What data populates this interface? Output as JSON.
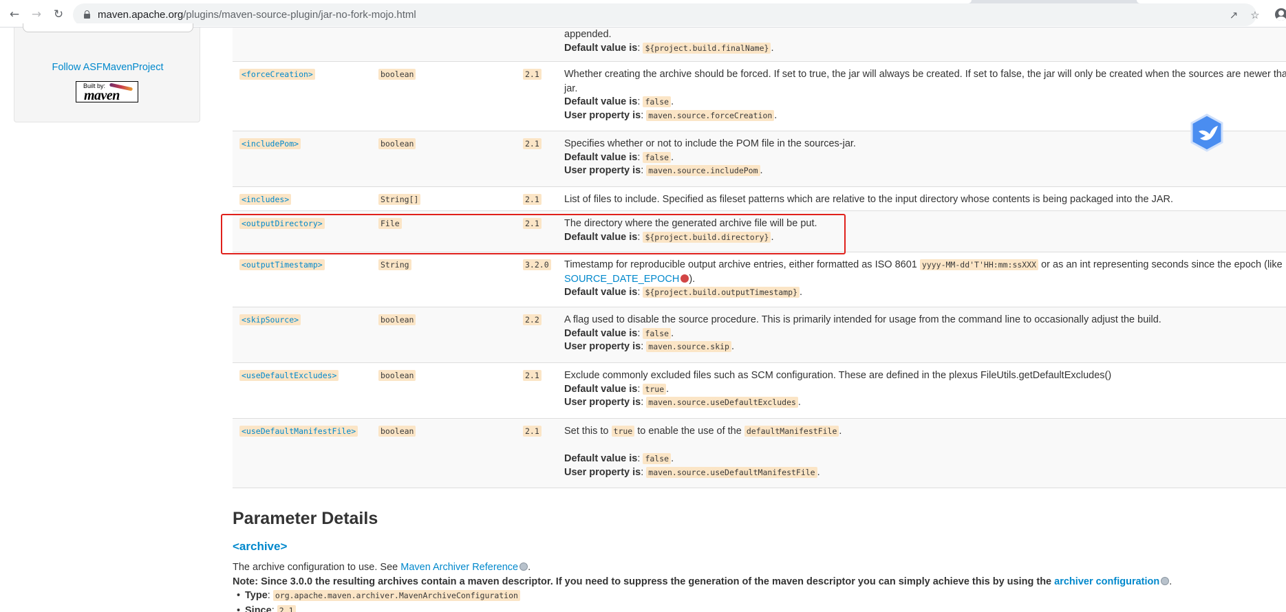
{
  "browser": {
    "url_domain": "maven.apache.org",
    "url_path": "/plugins/maven-source-plugin/jar-no-fork-mojo.html"
  },
  "sidebar": {
    "follow_link": "Follow ASFMavenProject",
    "built_by_small": "Built by:",
    "built_by_big": "maven"
  },
  "params": [
    {
      "name": "",
      "type": "",
      "since": "",
      "lines": [
        {
          "kind": "text",
          "text": "appended."
        },
        {
          "kind": "default",
          "label": "Default value is",
          "value": "${project.build.finalName}"
        }
      ]
    },
    {
      "name": "<forceCreation>",
      "type": "boolean",
      "since": "2.1",
      "lines": [
        {
          "kind": "text",
          "text": "Whether creating the archive should be forced. If set to true, the jar will always be created. If set to false, the jar will only be created when the sources are newer than the"
        },
        {
          "kind": "text",
          "text": "jar."
        },
        {
          "kind": "default",
          "label": "Default value is",
          "value": "false"
        },
        {
          "kind": "default",
          "label": "User property is",
          "value": "maven.source.forceCreation"
        }
      ]
    },
    {
      "name": "<includePom>",
      "type": "boolean",
      "since": "2.1",
      "lines": [
        {
          "kind": "text",
          "text": "Specifies whether or not to include the POM file in the sources-jar."
        },
        {
          "kind": "default",
          "label": "Default value is",
          "value": "false"
        },
        {
          "kind": "default",
          "label": "User property is",
          "value": "maven.source.includePom"
        }
      ]
    },
    {
      "name": "<includes>",
      "type": "String[]",
      "since": "2.1",
      "lines": [
        {
          "kind": "text",
          "text": "List of files to include. Specified as fileset patterns which are relative to the input directory whose contents is being packaged into the JAR."
        }
      ]
    },
    {
      "name": "<outputDirectory>",
      "type": "File",
      "since": "2.1",
      "lines": [
        {
          "kind": "text",
          "text": "The directory where the generated archive file will be put."
        },
        {
          "kind": "default",
          "label": "Default value is",
          "value": "${project.build.directory}"
        }
      ]
    },
    {
      "name": "<outputTimestamp>",
      "type": "String",
      "since": "3.2.0",
      "lines": [
        {
          "kind": "timestamp",
          "pre": "Timestamp for reproducible output archive entries, either formatted as ISO 8601 ",
          "code": "yyyy-MM-dd'T'HH:mm:ssXXX",
          "post": " or as an int representing seconds since the epoch (like"
        },
        {
          "kind": "linkline",
          "link": "SOURCE_DATE_EPOCH",
          "post": ")."
        },
        {
          "kind": "default",
          "label": "Default value is",
          "value": "${project.build.outputTimestamp}"
        }
      ]
    },
    {
      "name": "<skipSource>",
      "type": "boolean",
      "since": "2.2",
      "lines": [
        {
          "kind": "text",
          "text": "A flag used to disable the source procedure. This is primarily intended for usage from the command line to occasionally adjust the build."
        },
        {
          "kind": "default",
          "label": "Default value is",
          "value": "false"
        },
        {
          "kind": "default",
          "label": "User property is",
          "value": "maven.source.skip"
        }
      ]
    },
    {
      "name": "<useDefaultExcludes>",
      "type": "boolean",
      "since": "2.1",
      "lines": [
        {
          "kind": "text",
          "text": "Exclude commonly excluded files such as SCM configuration. These are defined in the plexus FileUtils.getDefaultExcludes()"
        },
        {
          "kind": "default",
          "label": "Default value is",
          "value": "true"
        },
        {
          "kind": "default",
          "label": "User property is",
          "value": "maven.source.useDefaultExcludes"
        }
      ]
    },
    {
      "name": "<useDefaultManifestFile>",
      "type": "boolean",
      "since": "2.1",
      "lines": [
        {
          "kind": "manifest",
          "pre": "Set this to ",
          "code1": "true",
          "mid": " to enable the use of the ",
          "code2": "defaultManifestFile",
          "post": "."
        },
        {
          "kind": "blank"
        },
        {
          "kind": "default",
          "label": "Default value is",
          "value": "false"
        },
        {
          "kind": "default",
          "label": "User property is",
          "value": "maven.source.useDefaultManifestFile"
        }
      ]
    }
  ],
  "details": {
    "heading": "Parameter Details",
    "archive_heading": "<archive>",
    "archive_desc_pre": "The archive configuration to use. See ",
    "archive_desc_link": "Maven Archiver Reference",
    "archive_desc_post": ".",
    "note_bold": "Note: Since 3.0.0 the resulting archives contain a maven descriptor. If you need to suppress the generation of the maven descriptor you can simply achieve this by using the ",
    "note_link": "archiver configuration",
    "note_post": ".",
    "type_label": "Type",
    "type_value": "org.apache.maven.archiver.MavenArchiveConfiguration",
    "since_label": "Since",
    "since_value": "2.1"
  },
  "colors": {
    "link": "#0088cc",
    "code_bg": "#fbe5c6",
    "highlight_border": "#e0201b",
    "row_alt": "#f9f9f9"
  }
}
